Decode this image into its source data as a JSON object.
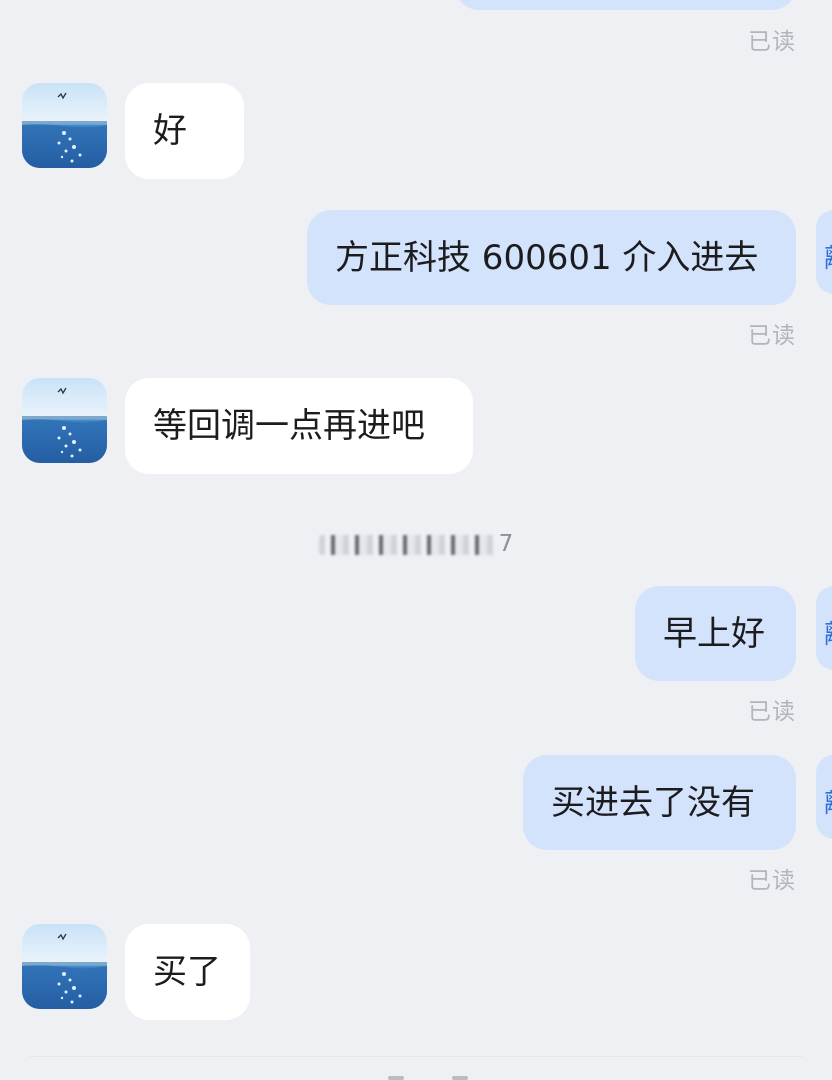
{
  "messages": [
    {
      "side": "out",
      "text": "",
      "read": "已读"
    },
    {
      "side": "in",
      "text": "好"
    },
    {
      "side": "out",
      "text": "方正科技 600601 介入进去",
      "read": "已读"
    },
    {
      "side": "in",
      "text": "等回调一点再进吧"
    },
    {
      "side": "out",
      "text": "早上好",
      "read": "已读"
    },
    {
      "side": "out",
      "text": "买进去了没有",
      "read": "已读"
    },
    {
      "side": "in",
      "text": "买了"
    }
  ],
  "timestamp": {
    "visible_suffix": "7"
  },
  "peer_avatar_glyph": "離",
  "icons": {
    "avatar": "sea-bird-avatar-icon"
  },
  "colors": {
    "background": "#eef0f4",
    "incoming_bubble": "#ffffff",
    "outgoing_bubble": "#d3e3fc",
    "read_receipt": "#b2b5bb"
  }
}
